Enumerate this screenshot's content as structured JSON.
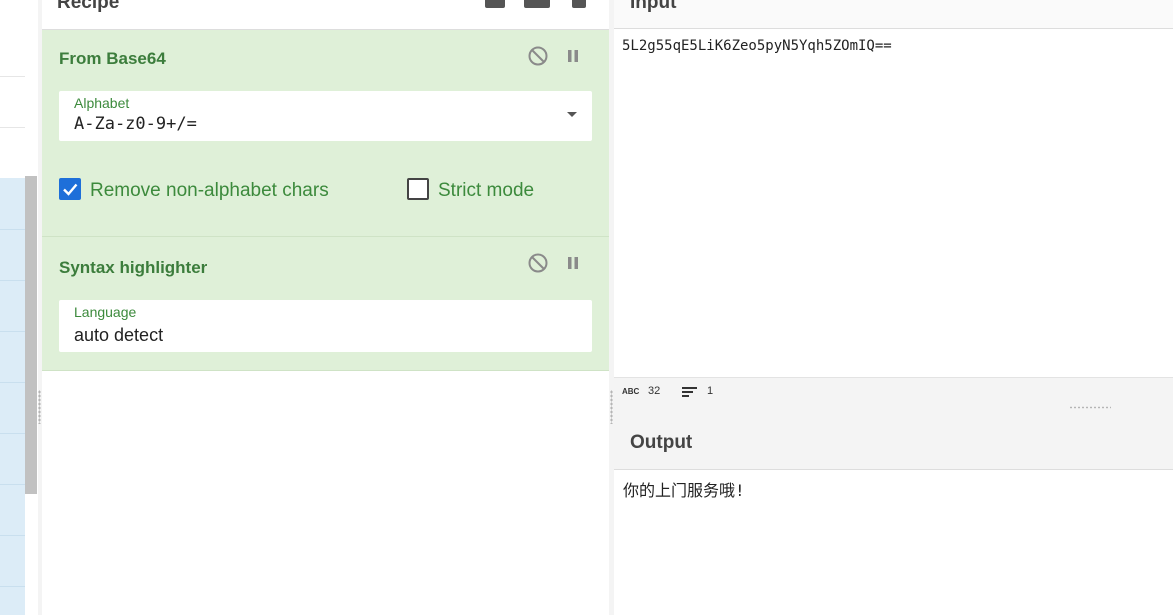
{
  "recipe": {
    "title": "Recipe",
    "icons": [
      "save-icon",
      "folder-icon",
      "delete-icon"
    ],
    "operations": [
      {
        "name": "From Base64",
        "field_label": "Alphabet",
        "field_value": "A-Za-z0-9+/=",
        "checkbox_remove_label": "Remove non-alphabet chars",
        "checkbox_remove_checked": true,
        "checkbox_strict_label": "Strict mode",
        "checkbox_strict_checked": false
      },
      {
        "name": "Syntax highlighter",
        "field_label": "Language",
        "field_value": "auto detect"
      }
    ]
  },
  "input": {
    "title": "Input",
    "text": "5L2g55qE5LiK6Zeo5pyN5Yqh5ZOmIQ==",
    "length": "32",
    "lines": "1"
  },
  "output": {
    "title": "Output",
    "text": "你的上门服务哦!"
  },
  "colors": {
    "op_background": "#dff0d8",
    "op_title": "#3c7d3c",
    "checkbox_checked": "#1e6fd9",
    "ops_highlight": "#dcecf7"
  }
}
